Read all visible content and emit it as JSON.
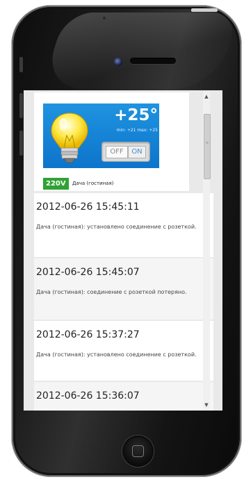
{
  "device": {
    "temperature": "+25°",
    "min_max": "min: +21 max: +25",
    "switch_off_label": "OFF",
    "switch_on_label": "ON",
    "voltage": "220V",
    "name": "Дача (гостиная)",
    "icon": "lightbulb-icon"
  },
  "log": [
    {
      "time": "2012-06-26 15:45:11",
      "message": "Дача (гостиная): установлено соединение с розеткой."
    },
    {
      "time": "2012-06-26 15:45:07",
      "message": "Дача (гостиная): соединение с розеткой потеряно."
    },
    {
      "time": "2012-06-26 15:37:27",
      "message": "Дача (гостиная): установлено соединение с розеткой."
    },
    {
      "time": "2012-06-26 15:36:07",
      "message": ""
    }
  ],
  "scrollbar": {
    "up_arrow": "▲",
    "down_arrow": "▼",
    "grip": "≡"
  },
  "colors": {
    "panel_blue": "#1585d8",
    "voltage_green": "#2fa234",
    "screen_bg": "#e9e9e9"
  }
}
